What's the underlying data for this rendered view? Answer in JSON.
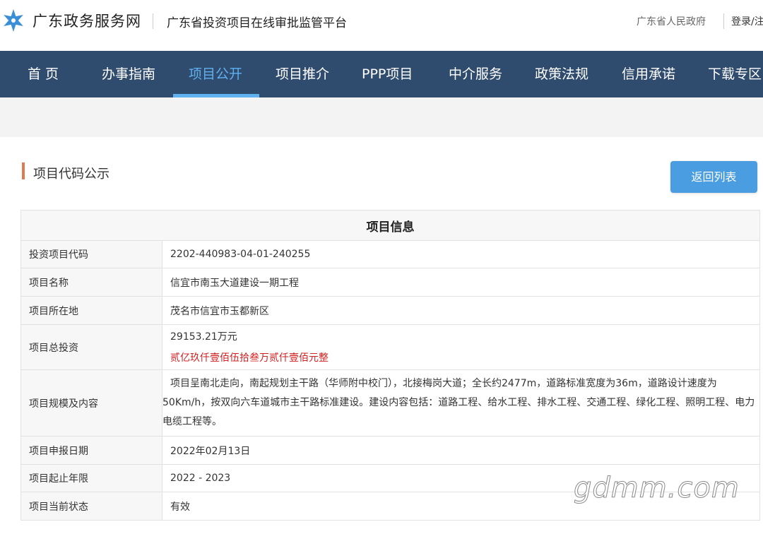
{
  "header": {
    "site_name": "广东政务服务网",
    "platform_name": "广东省投资项目在线审批监管平台",
    "gov_link": "广东省人民政府",
    "login_link": "登录/注"
  },
  "nav": {
    "items": [
      {
        "label": "首  页"
      },
      {
        "label": "办事指南"
      },
      {
        "label": "项目公开"
      },
      {
        "label": "项目推介"
      },
      {
        "label": "PPP项目"
      },
      {
        "label": "中介服务"
      },
      {
        "label": "政策法规"
      },
      {
        "label": "信用承诺"
      },
      {
        "label": "下载专区"
      }
    ],
    "active": "项目公开"
  },
  "main": {
    "section_title": "项目代码公示",
    "back_button": "返回列表",
    "table_header": "项目信息",
    "rows": [
      {
        "label": "投资项目代码",
        "value": "2202-440983-04-01-240255"
      },
      {
        "label": "项目名称",
        "value": "信宜市南玉大道建设一期工程"
      },
      {
        "label": "项目所在地",
        "value": "茂名市信宜市玉都新区"
      },
      {
        "label": "项目总投资",
        "value": "29153.21万元",
        "value_upper": "贰亿玖仟壹佰伍拾叁万贰仟壹佰元整"
      },
      {
        "label": "项目规模及内容",
        "value": "项目呈南北走向，南起规划主干路（华师附中校门），北接梅岗大道；全长约2477m，道路标准宽度为36m，道路设计速度为50Km/h，按双向六车道城市主干路标准建设。建设内容包括：道路工程、给水工程、排水工程、交通工程、绿化工程、照明工程、电力电缆工程等。"
      },
      {
        "label": "项目申报日期",
        "value": "2022年02月13日"
      },
      {
        "label": "项目起止年限",
        "value": "2022 - 2023"
      },
      {
        "label": "项目当前状态",
        "value": "有效"
      }
    ]
  },
  "watermark": "gdmm.com",
  "colors": {
    "nav_bg": "#2f4b6e",
    "accent": "#5fb1f0",
    "button": "#4a9de0",
    "title_bar": "#e07b4f",
    "amount_red": "#d02020"
  }
}
